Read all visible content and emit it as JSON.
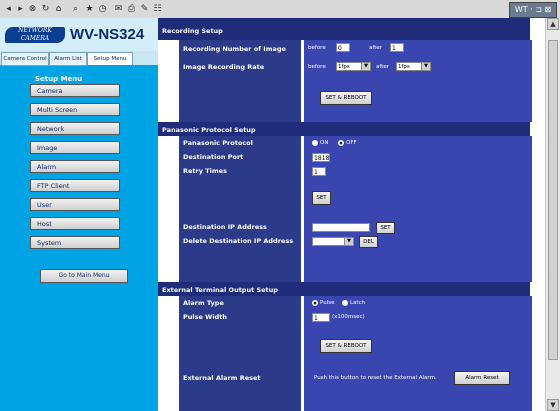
{
  "toolbar": {
    "icons": [
      "back-icon",
      "forward-icon",
      "stop-icon",
      "refresh-icon",
      "home-icon",
      "search-icon",
      "favorites-icon",
      "history-icon",
      "mail-icon",
      "print-icon",
      "edit-icon",
      "discuss-icon"
    ],
    "status_text": "WT · ⊐ ⊠"
  },
  "brand": {
    "logo_text": "NETWORK CAMERA",
    "model": "WV-NS324"
  },
  "tabs": [
    "Camera Control",
    "Alarm List",
    "Setup Menu"
  ],
  "setup_menu": {
    "title": "Setup Menu",
    "items": [
      "Camera",
      "Multi Screen",
      "Network",
      "Image",
      "Alarm",
      "FTP Client",
      "User",
      "Host",
      "System"
    ],
    "main_menu_button": "Go to Main Menu"
  },
  "recording": {
    "section_title": "Recording Setup",
    "num_label": "Recording Number of Image",
    "before_text": "before",
    "before_value": "0",
    "after_text": "after",
    "after_value": "1",
    "rate_label": "Image Recording Rate",
    "rate_before_text": "before",
    "rate_before_value": "1fps",
    "rate_after_text": "after",
    "rate_after_value": "1fps",
    "button": "SET & REBOOT"
  },
  "protocol": {
    "section_title": "Panasonic Protocol Setup",
    "protocol_label": "Panasonic Protocol",
    "on_text": "ON",
    "off_text": "OFF",
    "protocol_value": "OFF",
    "port_label": "Destination Port",
    "port_value": "1818",
    "retry_label": "Retry Times",
    "retry_value": "1",
    "set_button": "SET",
    "dest_ip_label": "Destination IP Address",
    "dest_ip_value": "",
    "dest_ip_button": "SET",
    "delete_label": "Delete Destination IP Address",
    "delete_value": "",
    "delete_button": "DEL"
  },
  "terminal": {
    "section_title": "External Terminal Output Setup",
    "alarm_type_label": "Alarm Type",
    "pulse_text": "Pulse",
    "latch_text": "Latch",
    "alarm_type_value": "Pulse",
    "pulse_width_label": "Pulse Width",
    "pulse_width_value": "1",
    "pulse_width_unit": "(x100msec)",
    "button": "SET & REBOOT"
  },
  "alarm_reset": {
    "label": "External Alarm Reset",
    "description": "Push this button to reset the External Alarm.",
    "button": "Alarm Reset"
  }
}
